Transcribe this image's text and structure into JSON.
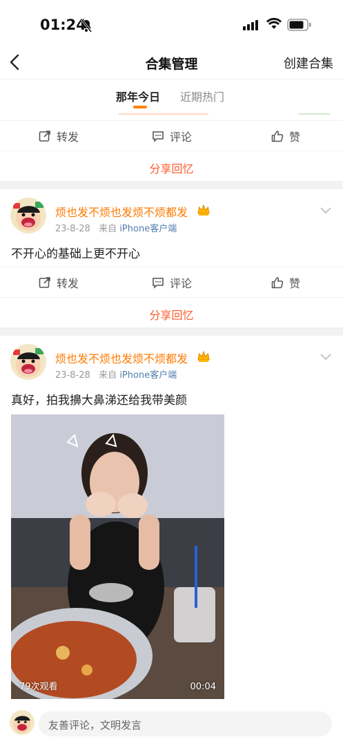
{
  "status_bar": {
    "time": "01:24"
  },
  "nav": {
    "title": "合集管理",
    "right_action": "创建合集"
  },
  "tabs": [
    {
      "label": "那年今日",
      "active": true
    },
    {
      "label": "近期热门",
      "active": false
    }
  ],
  "actions": {
    "repost": "转发",
    "comment": "评论",
    "like": "赞"
  },
  "share_label": "分享回忆",
  "posts": [
    {
      "username": "烦也发不烦也发烦不烦都发",
      "date": "23-8-28",
      "source_prefix": "来自",
      "client": "iPhone客户端",
      "text": "不开心的基础上更不开心"
    },
    {
      "username": "烦也发不烦也发烦不烦都发",
      "date": "23-8-28",
      "source_prefix": "来自",
      "client": "iPhone客户端",
      "text": "真好，拍我擤大鼻涕还给我带美颜",
      "video": {
        "views": "79次观看",
        "duration": "00:04"
      }
    }
  ],
  "comment_bar": {
    "placeholder": "友善评论，文明发言"
  },
  "colors": {
    "accent": "#ff8200",
    "username": "#ff7a00",
    "share": "#ff5a2c",
    "client_link": "#507daf"
  },
  "icons": [
    "bell-slash-icon",
    "signal-icon",
    "wifi-icon",
    "battery-icon",
    "back-icon",
    "repost-icon",
    "comment-icon",
    "like-icon",
    "chevron-down-icon",
    "crown-badge-icon"
  ]
}
